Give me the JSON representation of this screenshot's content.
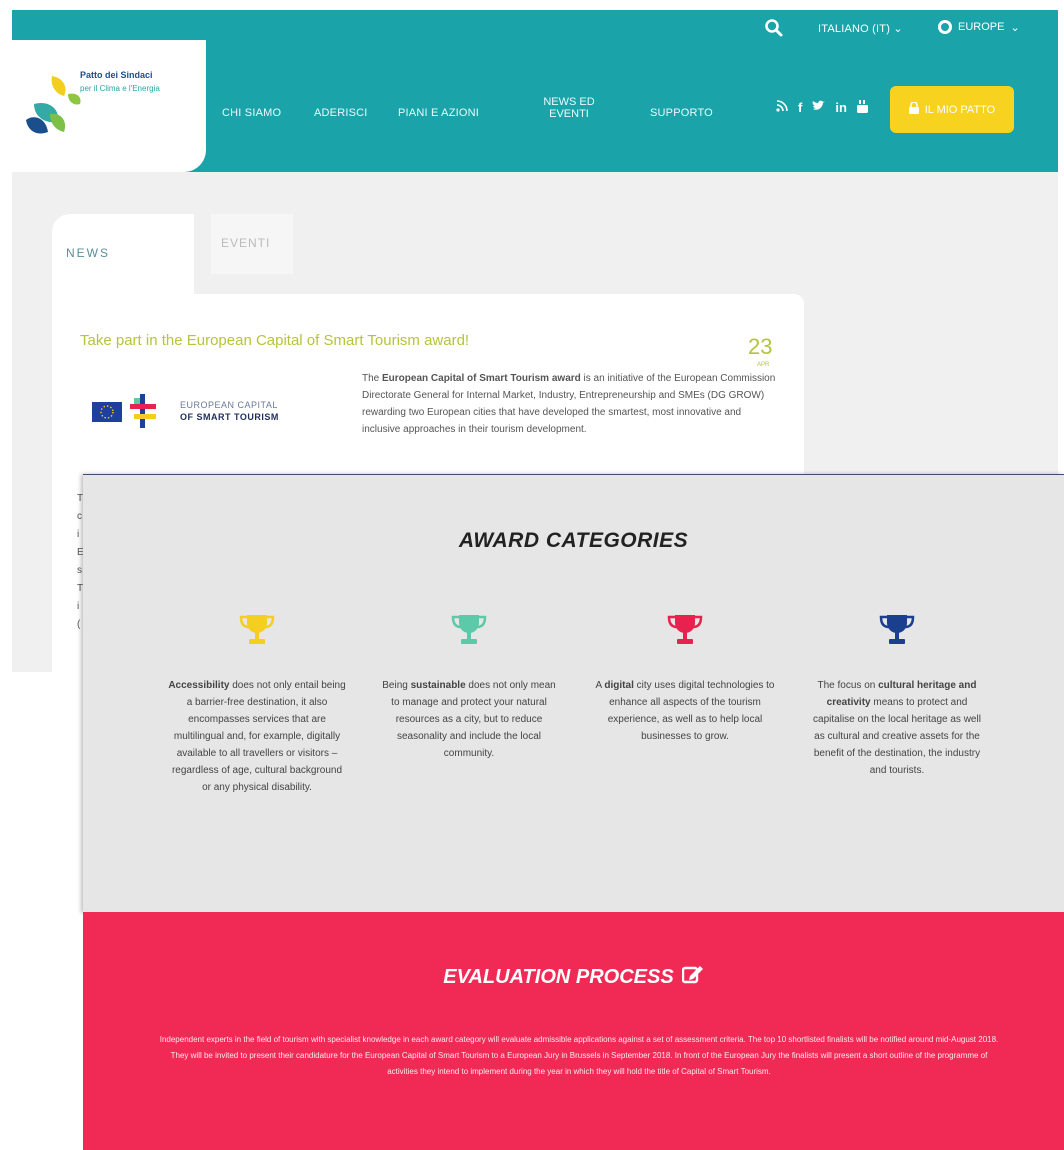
{
  "topbar": {
    "search_icon": "search-icon",
    "language": "ITALIANO (IT)",
    "region": "EUROPE"
  },
  "logo": {
    "title": "Patto dei Sindaci",
    "subtitle": "per il Clima e l'Energia"
  },
  "nav": {
    "items": [
      "CHI SIAMO",
      "ADERISCI",
      "PIANI E AZIONI",
      "NEWS ED EVENTI",
      "SUPPORTO"
    ]
  },
  "social": [
    "rss-icon",
    "facebook-icon",
    "twitter-icon",
    "linkedin-icon",
    "youtube-icon"
  ],
  "pact_button": "IL MIO PATTO",
  "tabs": {
    "news": "NEWS",
    "eventi": "EVENTI"
  },
  "news": {
    "title": "Take part in the European Capital of Smart Tourism award!",
    "day": "23",
    "month": "APR",
    "logo_line1": "EUROPEAN CAPITAL",
    "logo_line2": "OF SMART TOURISM",
    "body_prefix": "The ",
    "body_bold": "European Capital of Smart Tourism award",
    "body_rest": " is an initiative of the European Commission Directorate General for Internal Market, Industry, Entrepreneurship and SMEs (DG GROW) rewarding two European cities that have developed the smartest, most innovative and inclusive approaches in their tourism development.",
    "cut_chars": [
      "T",
      "c",
      "i",
      "E",
      "s",
      "",
      "T",
      "i",
      "("
    ]
  },
  "award": {
    "title": "AWARD CATEGORIES",
    "colors": {
      "accessibility": "#f4cf1f",
      "sustainable": "#5ccaa8",
      "digital": "#e8224e",
      "cultural": "#1b3f8f"
    },
    "categories": [
      {
        "pre": "",
        "bold": "Accessibility",
        "post": " does not only entail being a barrier-free destination, it also encompasses services that are multilingual and, for example, digitally available to all travellers or visitors – regardless of age, cultural background or any physical disability."
      },
      {
        "pre": "Being ",
        "bold": "sustainable",
        "post": " does not only mean to manage and protect your natural resources as a city, but to reduce seasonality and include the local community."
      },
      {
        "pre": "A ",
        "bold": "digital",
        "post": " city uses digital technologies to enhance all aspects of the tourism experience, as well as to help local businesses to grow."
      },
      {
        "pre": "The focus on ",
        "bold": "cultural heritage and creativity",
        "post": " means to protect and capitalise on the local heritage as well as cultural and creative assets for the benefit of the destination, the industry and tourists."
      }
    ]
  },
  "evaluation": {
    "title": "EVALUATION PROCESS",
    "icon": "edit-icon",
    "body": "Independent experts in the field of tourism with specialist knowledge in each award category will evaluate admissible applications against a set of assessment criteria. The top 10 shortlisted finalists will be notified around mid-August 2018. They will be invited to present their candidature for the European Capital of Smart Tourism to a European Jury in Brussels in September 2018. In front of the European Jury the finalists will present a short outline of the programme of activities they intend to implement during the year in which they will hold the title of Capital of Smart Tourism."
  }
}
